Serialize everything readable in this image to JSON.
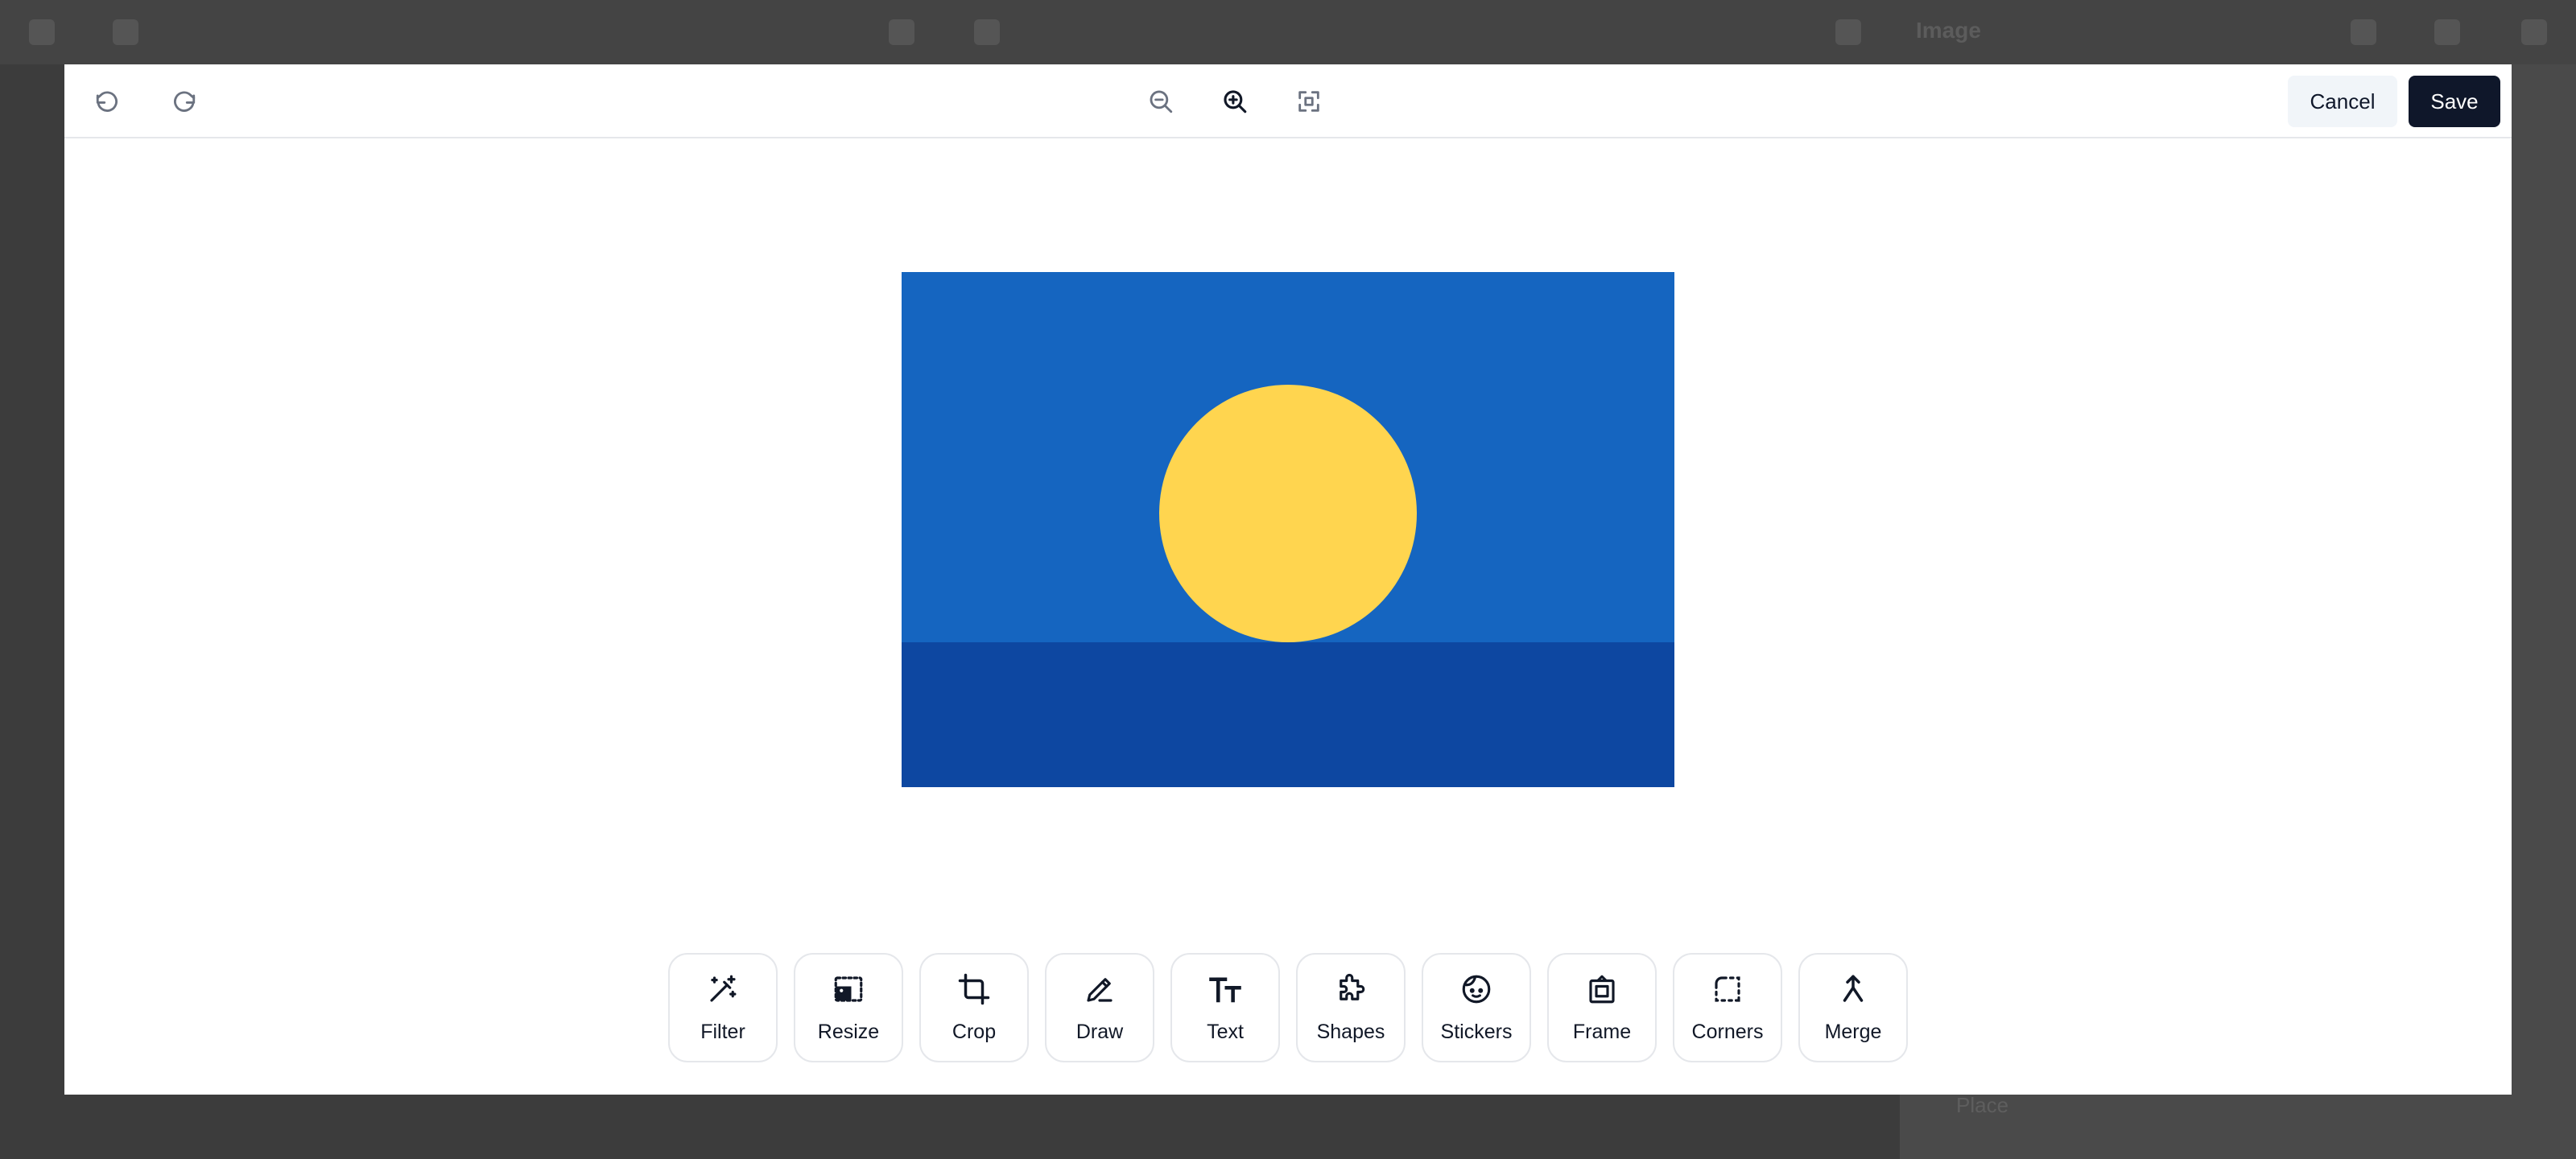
{
  "colors": {
    "overlay": "#3c3c3c",
    "accent": "#0f172a",
    "sky": "#1565c0",
    "sea": "#0d47a1",
    "sun": "#ffd54f"
  },
  "background_app": {
    "title": "Image",
    "panel_text": "Place"
  },
  "header": {
    "undo_icon": "undo-icon",
    "redo_icon": "redo-icon",
    "zoom_out_icon": "zoom-out-icon",
    "zoom_in_icon": "zoom-in-icon",
    "fit_icon": "fit-screen-icon",
    "cancel_label": "Cancel",
    "save_label": "Save"
  },
  "tools": [
    {
      "id": "filter",
      "label": "Filter",
      "icon": "magic-wand-icon"
    },
    {
      "id": "resize",
      "label": "Resize",
      "icon": "resize-image-icon"
    },
    {
      "id": "crop",
      "label": "Crop",
      "icon": "crop-icon"
    },
    {
      "id": "draw",
      "label": "Draw",
      "icon": "pencil-icon"
    },
    {
      "id": "text",
      "label": "Text",
      "icon": "text-icon"
    },
    {
      "id": "shapes",
      "label": "Shapes",
      "icon": "puzzle-icon"
    },
    {
      "id": "stickers",
      "label": "Stickers",
      "icon": "sticker-face-icon"
    },
    {
      "id": "frame",
      "label": "Frame",
      "icon": "frame-icon"
    },
    {
      "id": "corners",
      "label": "Corners",
      "icon": "corners-icon"
    },
    {
      "id": "merge",
      "label": "Merge",
      "icon": "merge-icon"
    }
  ]
}
